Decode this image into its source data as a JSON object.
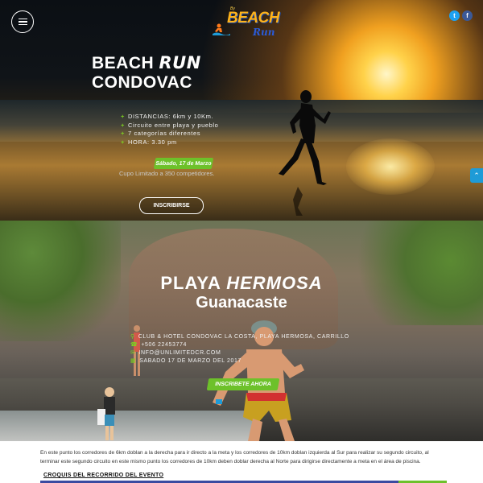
{
  "header": {
    "logo": {
      "by": "By",
      "word1": "BEACH",
      "word2": "Run"
    },
    "social": {
      "twitter": "t",
      "facebook": "f"
    }
  },
  "hero": {
    "title_line1_plain": "BEACH ",
    "title_line1_accent": "RUN",
    "title_line2": "CONDOVAC",
    "details": [
      "DISTANCIAS: 6km y 10Km.",
      "Circuito entre playa y pueblo",
      "7 categorías diferentes",
      "HORA: 3.30 pm"
    ],
    "date_badge": "Sábado, 17 de Marzo",
    "cupo": "Cupo Limitado a 350 competidores.",
    "cta": "INSCRIBIRSE",
    "side_tab_icon": "chevron-up-icon"
  },
  "location": {
    "title_plain": "PLAYA ",
    "title_accent": "HERMOSA",
    "subtitle": "Guanacaste",
    "contact": [
      {
        "icon": "map-pin-icon",
        "text": "CLUB & HOTEL CONDOVAC LA COSTA, PLAYA HERMOSA, CARRILLO"
      },
      {
        "icon": "phone-icon",
        "text": "+506 22453774"
      },
      {
        "icon": "email-icon",
        "text": "INFO@UNLIMITEDCR.COM"
      },
      {
        "icon": "calendar-icon",
        "text": "SABADO 17 DE MARZO DEL 2017"
      }
    ],
    "cta": "INSCRIBETE AHORA"
  },
  "info": {
    "paragraph": "En este punto los corredores de 6km doblan a la derecha para ir directo a la meta y los corredores de 10km doblan izquierda al Sur para realizar su segundo circuito, al terminar este segundo circuito en este mismo punto los corredores de 10km deben doblar derecha al Norte para dirigirse directamente a meta en el área de piscina.",
    "heading": "CROQUIS DEL RECORRIDO DEL EVENTO"
  },
  "colors": {
    "accent_green": "#6dc12a",
    "twitter": "#1da1f2",
    "facebook": "#3b5998",
    "side_tab": "#1e9bd7"
  }
}
